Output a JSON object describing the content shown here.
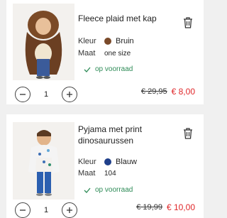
{
  "cart": {
    "items": [
      {
        "title": "Fleece plaid met kap",
        "color_label": "Kleur",
        "color_value": "Bruin",
        "color_swatch": "#7a4a2a",
        "size_label": "Maat",
        "size_value": "one size",
        "stock": "op voorraad",
        "quantity": "1",
        "old_price": "€ 29,95",
        "new_price": "€ 8,00"
      },
      {
        "title": "Pyjama met print dinosaurussen",
        "color_label": "Kleur",
        "color_value": "Blauw",
        "color_swatch": "#1f3f8a",
        "size_label": "Maat",
        "size_value": "104",
        "stock": "op voorraad",
        "quantity": "1",
        "old_price": "€ 19,99",
        "new_price": "€ 10,00"
      }
    ]
  },
  "colors": {
    "accent_price": "#e0272a",
    "stock_green": "#2e8b57"
  }
}
